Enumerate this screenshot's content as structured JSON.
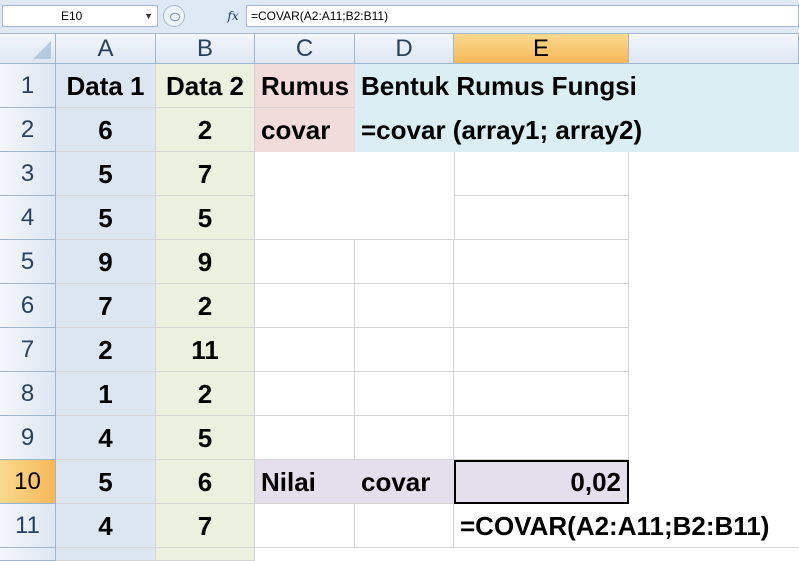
{
  "formula_bar": {
    "name_box": "E10",
    "fx_label": "fx",
    "formula": "=COVAR(A2:A11;B2:B11)"
  },
  "columns": [
    "A",
    "B",
    "C",
    "D",
    "E"
  ],
  "rows": [
    "1",
    "2",
    "3",
    "4",
    "5",
    "6",
    "7",
    "8",
    "9",
    "10",
    "11"
  ],
  "cells": {
    "A1": "Data 1",
    "B1": "Data 2",
    "C1": "Rumus",
    "D1": "Bentuk Rumus Fungsi",
    "C2": "covar",
    "D2": "=covar  (array1; array2)",
    "A": [
      "6",
      "5",
      "5",
      "9",
      "7",
      "2",
      "1",
      "4",
      "5",
      "4"
    ],
    "B": [
      "2",
      "7",
      "5",
      "9",
      "2",
      "11",
      "2",
      "5",
      "6",
      "7"
    ],
    "C10": "Nilai",
    "D10": "covar",
    "E10": "0,02",
    "E11": "=COVAR(A2:A11;B2:B11)"
  },
  "colors": {
    "col_a_fill": "#dce6f1",
    "col_b_fill": "#ebf1de",
    "rumus_fill": "#f2dcdb",
    "bentuk_fill": "#daeef3",
    "nilai_fill": "#e4dfec",
    "selected_header": "#f6b858"
  }
}
